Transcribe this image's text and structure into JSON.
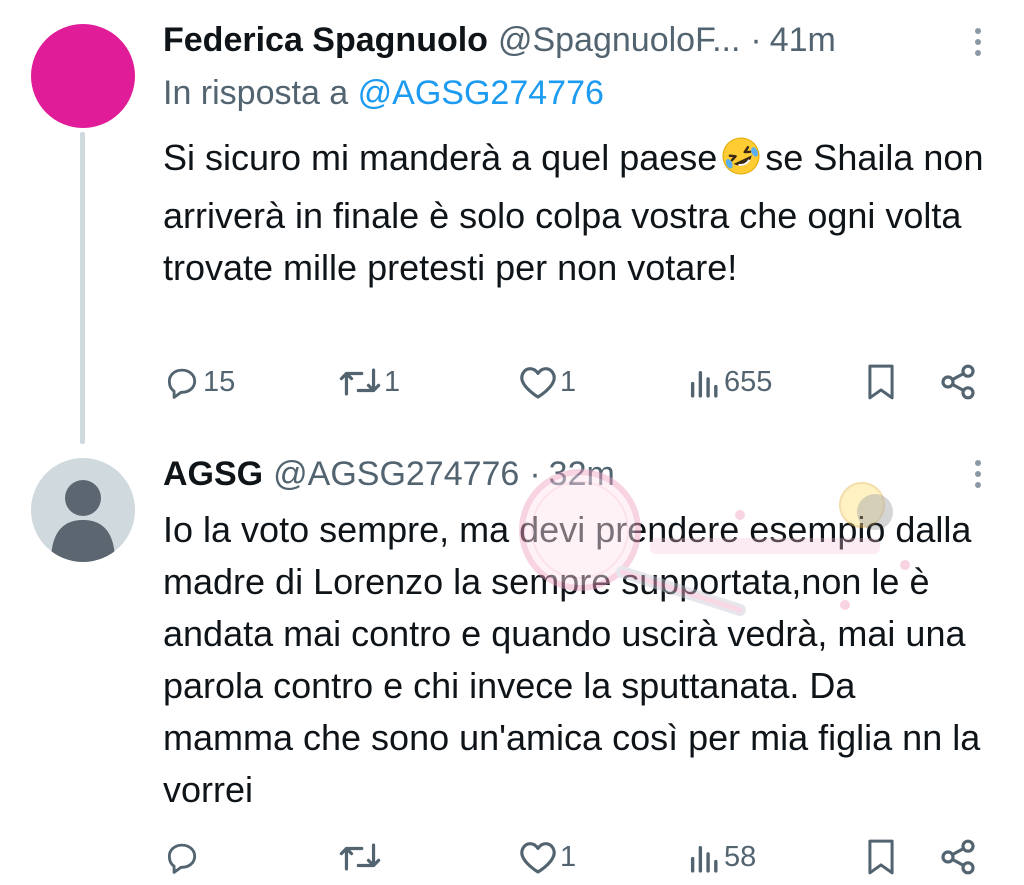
{
  "tweets": [
    {
      "name": "Federica Spagnuolo",
      "handle": "@SpagnuoloF...",
      "separator": "·",
      "time": "41m",
      "reply_prefix": "In risposta a",
      "reply_mention": "@AGSG274776",
      "text_before_emoji": "Si sicuro mi manderà a quel paese",
      "emoji": "rolling-on-floor-laughing-emoji",
      "text_after_emoji": "se Shaila non arriverà in finale è solo colpa vostra che ogni volta trovate mille pretesti per non votare!",
      "avatar_color": "#e01c98",
      "replies": "15",
      "retweets": "1",
      "likes": "1",
      "views": "655"
    },
    {
      "name": "AGSG",
      "handle": "@AGSG274776",
      "separator": "·",
      "time": "32m",
      "text": "Io la voto sempre, ma devi prendere esempio dalla madre di Lorenzo la sempre supportata,non le è andata mai contro e quando uscirà vedrà, mai una parola contro e chi invece la sputtanata. Da mamma che sono un'amica così per mia figlia nn la vorrei",
      "avatar_color": "#cfd9de",
      "replies": "",
      "retweets": "",
      "likes": "1",
      "views": "58"
    }
  ],
  "colors": {
    "text": "#0f1419",
    "secondary": "#536471",
    "link": "#1d9bf0",
    "thread_line": "#cfd9de"
  }
}
